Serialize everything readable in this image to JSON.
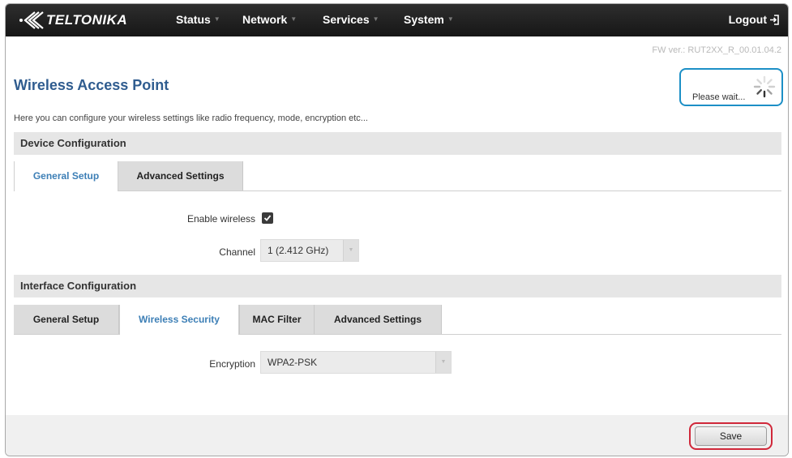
{
  "header": {
    "brand": "TELTONIKA",
    "nav": [
      {
        "label": "Status"
      },
      {
        "label": "Network"
      },
      {
        "label": "Services"
      },
      {
        "label": "System"
      }
    ],
    "logout_label": "Logout"
  },
  "firmware_version": "FW ver.: RUT2XX_R_00.01.04.2",
  "page": {
    "title": "Wireless Access Point",
    "description": "Here you can configure your wireless settings like radio frequency, mode, encryption etc..."
  },
  "status": {
    "loading_text": "Please wait...",
    "highlight_color": "#1c8fc6"
  },
  "device_config": {
    "heading": "Device Configuration",
    "tabs": [
      {
        "label": "General Setup",
        "active": true
      },
      {
        "label": "Advanced Settings",
        "active": false
      }
    ],
    "enable_wireless": {
      "label": "Enable wireless",
      "checked": true
    },
    "channel": {
      "label": "Channel",
      "value": "1 (2.412 GHz)"
    }
  },
  "interface_config": {
    "heading": "Interface Configuration",
    "tabs": [
      {
        "label": "General Setup",
        "active": false
      },
      {
        "label": "Wireless Security",
        "active": true
      },
      {
        "label": "MAC Filter",
        "active": false
      },
      {
        "label": "Advanced Settings",
        "active": false
      }
    ],
    "encryption": {
      "label": "Encryption",
      "value": "WPA2-PSK"
    }
  },
  "footer": {
    "save_label": "Save",
    "highlight_color": "#d0283a"
  }
}
